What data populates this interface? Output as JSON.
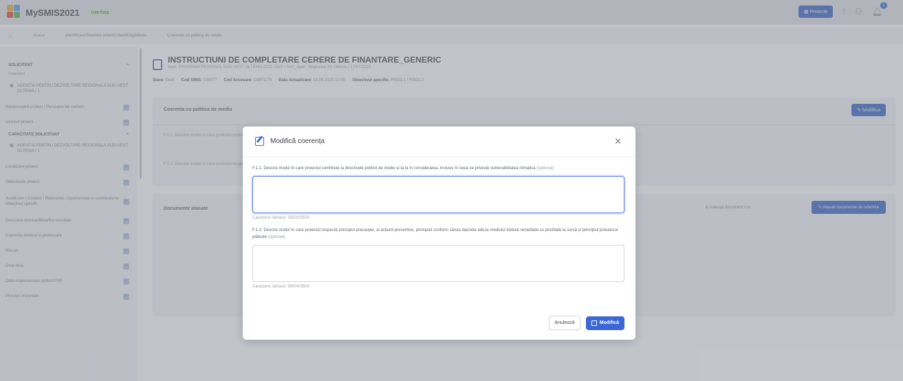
{
  "app": {
    "brand": "MySMIS2021",
    "env_badge": "Interfata"
  },
  "topbar": {
    "projects_button": "Proiecte",
    "notification_count": "1"
  },
  "breadcrumb": [
    "Acasa",
    "Identificare/Stabilire criteri/Criterii/Eligibilitate",
    "Coerenta cu politica de mediu"
  ],
  "sidebar": {
    "section1": "SOLICITANT",
    "section1_sub": "Solicitant",
    "entity1": "AGENTIA PENTRU DEZVOLTARE REGIONALA SUD-VEST OLTENIA / 1",
    "items_a": [
      {
        "label": "Responsabili proiect / Persoane de contact"
      },
      {
        "label": "Istoricul proiect"
      }
    ],
    "section2": "CAPACITATE SOLICITANT",
    "entity2": "AGENTIA PENTRU DEZVOLTARE REGIONALA SUD-VEST OLTENIA / 1",
    "items_b": [
      {
        "label": "Localizare proiect"
      },
      {
        "label": "Obiectivele proiect"
      },
      {
        "label": "Justificare / Context / Relevanta / Oportunitate si contributia la obiectivul specific"
      },
      {
        "label": "Descriere tehnica/Beneficii rezultate"
      },
      {
        "label": "Coerenta tehnica si promovare"
      },
      {
        "label": "Riscuri"
      },
      {
        "label": "Grup tinta"
      },
      {
        "label": "Date implementare proiect FNF"
      },
      {
        "label": "Principii orizontale"
      }
    ]
  },
  "page": {
    "title": "INSTRUCTIUNI DE COMPLETARE CERERE DE FINANTARE_GENERIC",
    "subtitle": "Apel: PROGRAM REGIONAL SUD-VEST OLTENIA 2021-2027 / Test_Apel - Regiunea SV Oltenia / 17/07/2023",
    "meta": {
      "stare_label": "Stare:",
      "stare": "Draft",
      "cod_label": "Cod SMIS:",
      "cod": "100077",
      "cod_ac_label": "Cod Accesare:",
      "cod_ac": "CMP1178",
      "data_label": "Data Actualizare:",
      "data": "13.09.2023 10:00",
      "obj_label": "Obiectivul specific:",
      "obj": "RSO2.1 / RSO2.2"
    },
    "card1_title": "Coerenta cu politica de mediu",
    "card1_button": "Modifica",
    "card1_rows": [
      "F.1.1. Descrie modul in care proiectul contribuie la directivele politicii de mediu...",
      "F.1.2. Descrie modul in care proiectul respecta principiul precautiei, al actiunii preventive, principiul corectarii cu prioritate la sursa a daunelor..."
    ],
    "card2_title": "Documente atasate",
    "card2_add": "Adauga document nou",
    "card2_button": "Atasati documente de referinta"
  },
  "modal": {
    "title": "Modifică coerența",
    "field1_label": "F.1.1. Descrie modul în care proiectul contribuie la directivele politicii de mediu și la la în considerarea, inclusiv în ceea ce privește vulnerabilitatea climatica",
    "field1_opt": "(optional)",
    "field1_value": "",
    "field1_counter": "Caractere rămase: 35000/3500",
    "field2_label": "F.1.2. Descrie modul în care proiectul respectă principiul precauției, al acțiunii preventive, principiul conform căruia daunele aduse mediului trebuie remediate cu prioritate la sursă și principiul poluatorul plătește",
    "field2_opt": "(optional)",
    "field2_value": "",
    "field2_counter": "Caractere rămase: 35000/3500",
    "cancel": "Anulează",
    "save": "Modifică"
  },
  "colors": {
    "accent": "#3b66d6",
    "overlay": "#787e86"
  }
}
